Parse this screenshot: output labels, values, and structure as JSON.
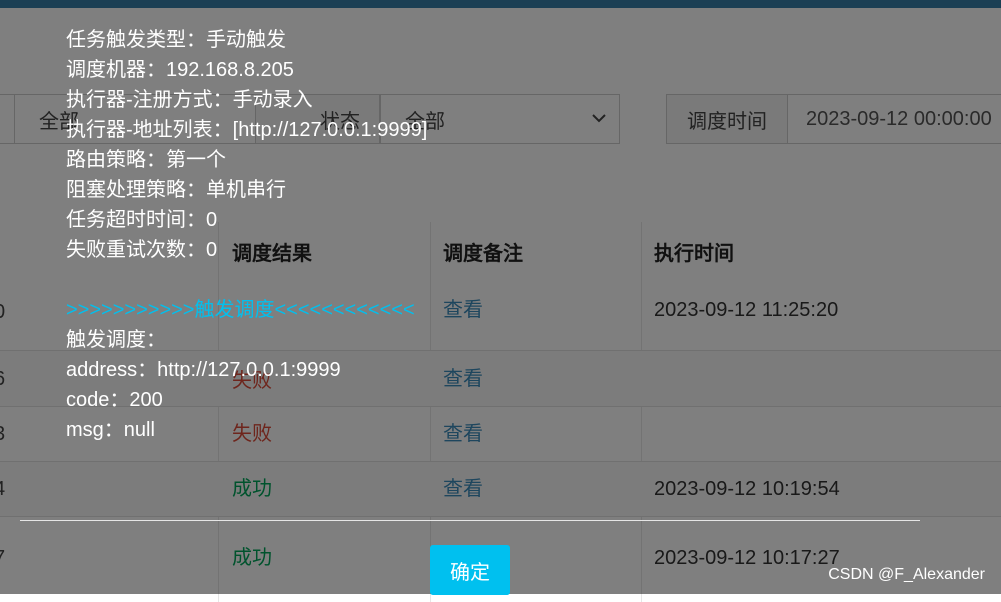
{
  "filters": {
    "select1_value": "全部",
    "status_label": "状态",
    "status_value": "全部",
    "time_label": "调度时间",
    "time_value": "2023-09-12 00:00:00"
  },
  "table": {
    "headers": {
      "result": "调度结果",
      "remark": "调度备注",
      "exec_time": "执行时间"
    },
    "rows": [
      {
        "id": "0",
        "result": "",
        "remark": "查看",
        "exec_time": "2023-09-12 11:25:20"
      },
      {
        "id": "6",
        "result": "失败",
        "remark": "查看",
        "exec_time": ""
      },
      {
        "id": "3",
        "result": "失败",
        "remark": "查看",
        "exec_time": ""
      },
      {
        "id": "4",
        "result": "成功",
        "remark": "查看",
        "exec_time": "2023-09-12 10:19:54"
      },
      {
        "id": "7",
        "result": "成功",
        "remark": "",
        "exec_time": "2023-09-12 10:17:27"
      }
    ]
  },
  "dialog": {
    "lines": [
      "任务触发类型：手动触发",
      "调度机器：192.168.8.205",
      "执行器-注册方式：手动录入",
      "执行器-地址列表：[http://127.0.0.1:9999]",
      "路由策略：第一个",
      "阻塞处理策略：单机串行",
      "任务超时时间：0",
      "失败重试次数：0"
    ],
    "trigger_line": ">>>>>>>>>>>触发调度<<<<<<<<<<<<",
    "detail_lines": [
      "触发调度：",
      "address：http://127.0.0.1:9999",
      "code：200",
      "msg：null"
    ],
    "ok_label": "确定"
  },
  "watermark": "CSDN @F_Alexander",
  "colors": {
    "accent": "#00c0ef",
    "success": "#00a65a",
    "fail": "#dd4b39",
    "link": "#3c8dbc"
  }
}
